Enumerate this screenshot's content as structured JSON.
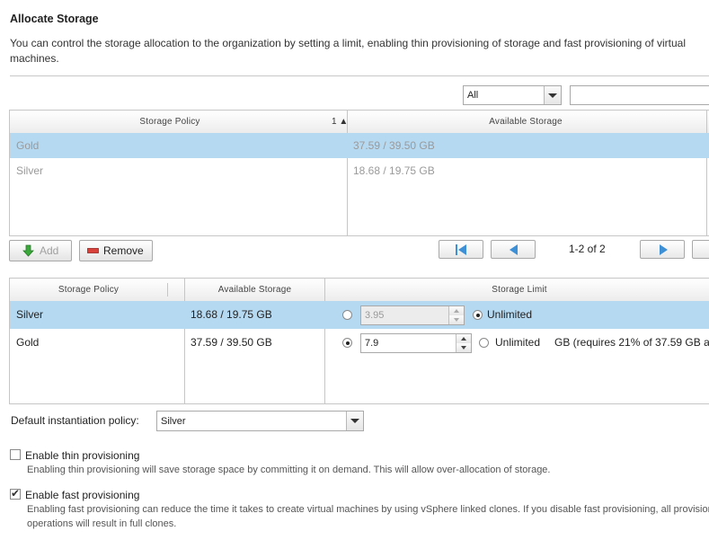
{
  "section": {
    "title": "Allocate Storage",
    "description": "You can control the storage allocation to the organization by setting a limit, enabling thin provisioning of storage and fast provisioning of virtual machines."
  },
  "filter": {
    "selected": "All",
    "search_value": ""
  },
  "policy_grid": {
    "columns": [
      "Storage Policy",
      "Available Storage"
    ],
    "sort_indicator": "1 ▲",
    "rows": [
      {
        "policy": "Gold",
        "available": "37.59 / 39.50 GB"
      },
      {
        "policy": "Silver",
        "available": "18.68 / 19.75 GB"
      }
    ]
  },
  "actions": {
    "add_label": "Add",
    "remove_label": "Remove"
  },
  "pagination": {
    "text": "1-2 of 2"
  },
  "limit_grid": {
    "columns": [
      "Storage Policy",
      "Available Storage",
      "Storage Limit"
    ],
    "rows": [
      {
        "policy": "Silver",
        "available": "18.68 / 19.75 GB",
        "limit_value": "3.95",
        "unlimited_label": "Unlimited",
        "suffix": ""
      },
      {
        "policy": "Gold",
        "available": "37.59 / 39.50 GB",
        "limit_value": "7.9",
        "unlimited_label": "Unlimited",
        "suffix": "GB (requires 21% of 37.59 GB a"
      }
    ]
  },
  "default_policy": {
    "label": "Default instantiation policy:",
    "selected": "Silver"
  },
  "thin": {
    "label": "Enable thin provisioning",
    "checked": false,
    "description": "Enabling thin provisioning will save storage space by committing it on demand. This will allow over-allocation of storage."
  },
  "fast": {
    "label": "Enable fast provisioning",
    "checked": true,
    "description_line1": "Enabling fast provisioning can reduce the time it takes to create virtual machines by using vSphere linked clones. If you disable fast provisioning, all provisioni",
    "description_line2": "operations will result in full clones."
  },
  "icons": {
    "add": "green-down-arrow-icon",
    "remove": "red-minus-icon",
    "first": "first-page-icon",
    "prev": "previous-page-icon",
    "next": "next-page-icon",
    "last": "last-page-icon"
  },
  "colors": {
    "selected_row": "#b6d9f2",
    "pager_arrow": "#3d8fd6"
  }
}
